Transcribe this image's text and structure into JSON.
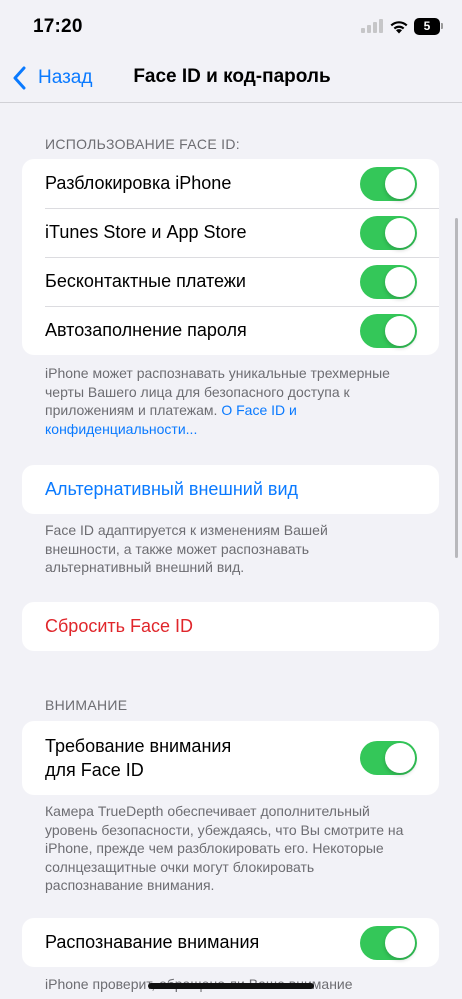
{
  "status_bar": {
    "time": "17:20",
    "battery": "5"
  },
  "nav": {
    "back_label": "Назад",
    "title": "Face ID и код-пароль"
  },
  "use_face_id": {
    "header": "ИСПОЛЬЗОВАНИЕ FACE ID:",
    "items": [
      {
        "label": "Разблокировка iPhone",
        "on": true
      },
      {
        "label": "iTunes Store и App Store",
        "on": true
      },
      {
        "label": "Бесконтактные платежи",
        "on": true
      },
      {
        "label": "Автозаполнение пароля",
        "on": true
      }
    ],
    "footer_text": "iPhone может распознавать уникальные трехмерные черты Вашего лица для безопасного доступа к приложениям и платежам. ",
    "footer_link": "О Face ID и конфиденциальности..."
  },
  "alternative_look": {
    "label": "Альтернативный внешний вид",
    "footer": "Face ID адаптируется к изменениям Вашей внешности, а также может распознавать альтернативный внешний вид."
  },
  "reset": {
    "label": "Сбросить Face ID"
  },
  "attention": {
    "header": "ВНИМАНИЕ",
    "require_label_line1": "Требование внимания",
    "require_label_line2": "для Face ID",
    "require_on": true,
    "require_footer": "Камера TrueDepth обеспечивает дополнительный уровень безопасности, убеждаясь, что Вы смотрите на iPhone, прежде чем разблокировать его. Некоторые солнцезащитные очки могут блокировать распознавание внимания.",
    "aware_label": "Распознавание внимания",
    "aware_on": true,
    "aware_footer": "iPhone проверит, обращено ли Ваше внимание"
  },
  "colors": {
    "accent": "#0a7aff",
    "toggle_on": "#34c759",
    "destructive": "#e0262b",
    "background": "#f2f2f7"
  },
  "icons": {
    "back": "chevron-left-icon",
    "signal": "cellular-signal-icon",
    "wifi": "wifi-icon",
    "battery": "battery-icon"
  }
}
